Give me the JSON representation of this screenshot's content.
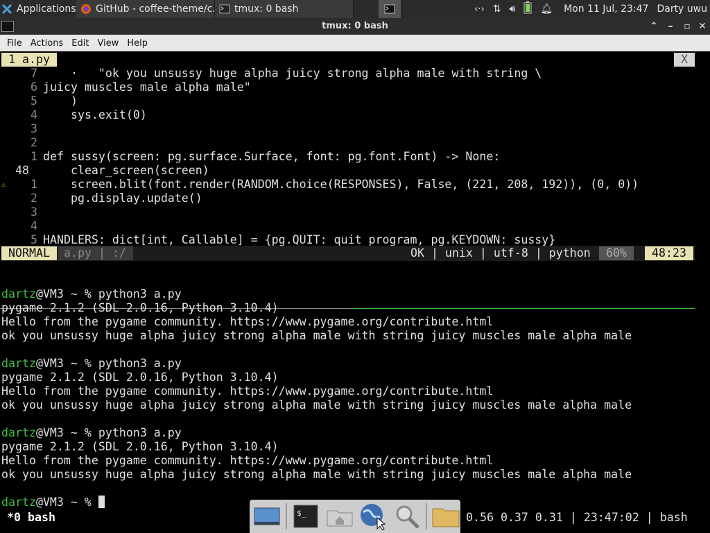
{
  "panel": {
    "apps_label": "Applications",
    "tasks": [
      {
        "label": "GitHub - coffee-theme/c...",
        "icon": "firefox-icon"
      },
      {
        "label": "tmux: 0 bash",
        "icon": "terminal-icon"
      }
    ],
    "clock": "Mon 11 Jul, 23:47",
    "user": "Darty uwu"
  },
  "window": {
    "title": "tmux: 0 bash",
    "menu": [
      "File",
      "Actions",
      "Edit",
      "View",
      "Help"
    ]
  },
  "vim": {
    "tab_label": "1 a.py",
    "tab_close": "X",
    "lines": [
      {
        "ln": "7",
        "text": "    ·   \"ok you unsussy huge alpha juicy strong alpha male with string \\"
      },
      {
        "ln": "6",
        "text": "juicy muscles male alpha male\""
      },
      {
        "ln": "5",
        "text": "    )"
      },
      {
        "ln": "4",
        "text": "    sys.exit(0)"
      },
      {
        "ln": "3",
        "text": ""
      },
      {
        "ln": "2",
        "text": ""
      },
      {
        "ln": "1",
        "text": "def sussy(screen: pg.surface.Surface, font: pg.font.Font) -> None:"
      },
      {
        "ln": "48",
        "text": "    clear_screen(screen)"
      },
      {
        "ln": "1",
        "text": "    screen.blit(font.render(RANDOM.choice(RESPONSES), False, (221, 208, 192)), (0, 0))"
      },
      {
        "ln": "2",
        "text": "    pg.display.update()"
      },
      {
        "ln": "3",
        "text": ""
      },
      {
        "ln": "4",
        "text": ""
      },
      {
        "ln": "5",
        "text": "HANDLERS: dict[int, Callable] = {pg.QUIT: quit_program, pg.KEYDOWN: sussy}"
      }
    ],
    "status": {
      "mode": "NORMAL",
      "file": "a.py | :/",
      "info": "OK | unix | utf-8 | python",
      "percent": "60%",
      "position": "48:23"
    }
  },
  "shell": {
    "user": "dartz",
    "host_prompt": "@VM3 ~ % ",
    "command": "python3 a.py",
    "runs": [
      {
        "lines": [
          "pygame 2.1.2 (SDL 2.0.16, Python 3.10.4)",
          "Hello from the pygame community. https://www.pygame.org/contribute.html",
          "ok you unsussy huge alpha juicy strong alpha male with string juicy muscles male alpha male"
        ]
      },
      {
        "lines": [
          "pygame 2.1.2 (SDL 2.0.16, Python 3.10.4)",
          "Hello from the pygame community. https://www.pygame.org/contribute.html",
          "ok you unsussy huge alpha juicy strong alpha male with string juicy muscles male alpha male"
        ]
      },
      {
        "lines": [
          "pygame 2.1.2 (SDL 2.0.16, Python 3.10.4)",
          "Hello from the pygame community. https://www.pygame.org/contribute.html",
          "ok you unsussy huge alpha juicy strong alpha male with string juicy muscles male alpha male"
        ]
      }
    ]
  },
  "tmux": {
    "window": "*0 bash",
    "right": "0.56 0.37 0.31 | 23:47:02 | bash"
  },
  "dock": {
    "items": [
      "show-desktop-icon",
      "terminal-icon",
      "home-folder-icon",
      "web-browser-icon",
      "search-icon",
      "folder-icon"
    ]
  }
}
